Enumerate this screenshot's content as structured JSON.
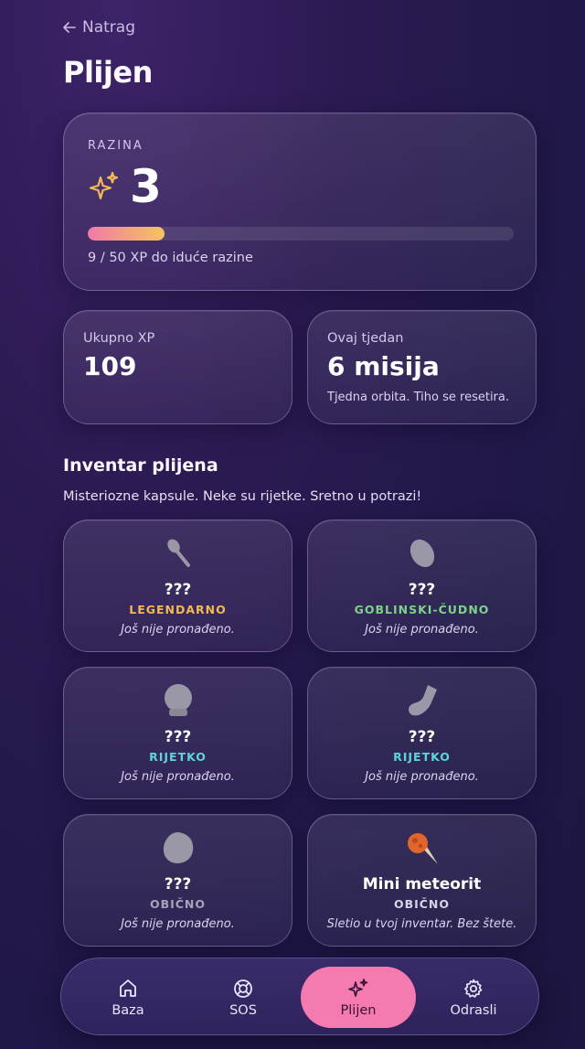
{
  "header": {
    "back_label": "Natrag",
    "title": "Plijen"
  },
  "level": {
    "label": "RAZINA",
    "value": "3",
    "progress": 0.18,
    "progress_text": "9 / 50 XP do iduće razine"
  },
  "stats": [
    {
      "label": "Ukupno XP",
      "value": "109",
      "sub": ""
    },
    {
      "label": "Ovaj tjedan",
      "value": "6 misija",
      "sub": "Tjedna orbita. Tiho se resetira."
    }
  ],
  "inventory": {
    "title": "Inventar plijena",
    "subtitle": "Misteriozne kapsule. Neke su rijetke. Sretno u potrazi!",
    "items": [
      {
        "icon": "spoon-icon",
        "name": "???",
        "rarity": "LEGENDARNO",
        "rarity_color": "#f2b955",
        "desc": "Još nije pronađeno."
      },
      {
        "icon": "bean-icon",
        "name": "???",
        "rarity": "GOBLINSKI-ČUDNO",
        "rarity_color": "#7fd28a",
        "desc": "Još nije pronađeno."
      },
      {
        "icon": "crystal-ball-icon",
        "name": "???",
        "rarity": "RIJETKO",
        "rarity_color": "#5fd3dd",
        "desc": "Još nije pronađeno."
      },
      {
        "icon": "sock-icon",
        "name": "???",
        "rarity": "RIJETKO",
        "rarity_color": "#5fd3dd",
        "desc": "Još nije pronađeno."
      },
      {
        "icon": "blob-icon",
        "name": "???",
        "rarity": "OBIČNO",
        "rarity_color": "#a9a2bd",
        "desc": "Još nije pronađeno."
      },
      {
        "icon": "meteor-icon",
        "name": "Mini meteorit",
        "rarity": "OBIČNO",
        "rarity_color": "#d8d2e6",
        "desc": "Sletio u tvoj inventar. Bez štete."
      }
    ]
  },
  "nav": [
    {
      "icon": "home-icon",
      "label": "Baza",
      "active": false
    },
    {
      "icon": "lifebuoy-icon",
      "label": "SOS",
      "active": false
    },
    {
      "icon": "sparkles-icon",
      "label": "Plijen",
      "active": true
    },
    {
      "icon": "gear-icon",
      "label": "Odrasli",
      "active": false
    }
  ],
  "colors": {
    "accent_pink": "#f47ab0",
    "xp_gradient_start": "#f07aa8",
    "xp_gradient_end": "#f6c45b"
  }
}
